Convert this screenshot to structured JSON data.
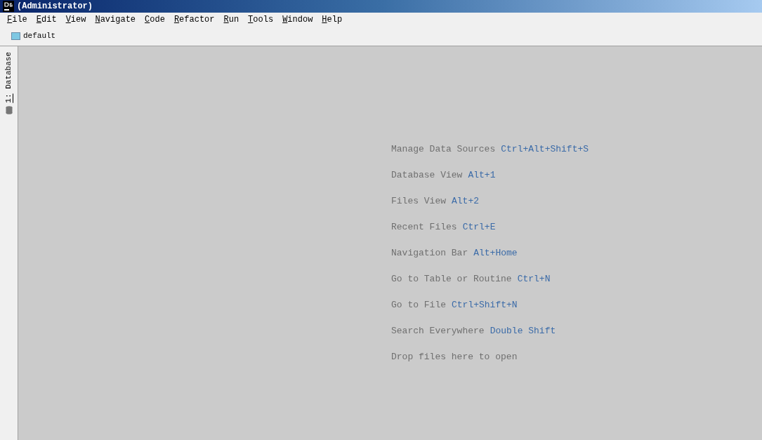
{
  "window": {
    "title": "(Administrator)"
  },
  "menu": [
    "File",
    "Edit",
    "View",
    "Navigate",
    "Code",
    "Refactor",
    "Run",
    "Tools",
    "Window",
    "Help"
  ],
  "breadcrumb": {
    "label": "default"
  },
  "side_tab": {
    "label": "1: Database"
  },
  "hints": [
    {
      "text": "Manage Data Sources",
      "shortcut": "Ctrl+Alt+Shift+S"
    },
    {
      "text": "Database View",
      "shortcut": "Alt+1"
    },
    {
      "text": "Files View",
      "shortcut": "Alt+2"
    },
    {
      "text": "Recent Files",
      "shortcut": "Ctrl+E"
    },
    {
      "text": "Navigation Bar",
      "shortcut": "Alt+Home"
    },
    {
      "text": "Go to Table or Routine",
      "shortcut": "Ctrl+N"
    },
    {
      "text": "Go to File",
      "shortcut": "Ctrl+Shift+N"
    },
    {
      "text": "Search Everywhere",
      "shortcut": "Double Shift"
    },
    {
      "text": "Drop files here to open"
    }
  ]
}
